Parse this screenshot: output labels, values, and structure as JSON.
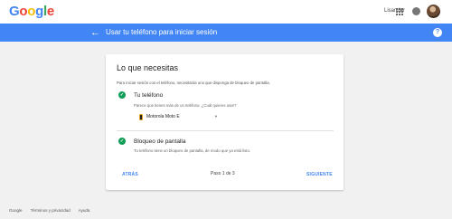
{
  "header": {
    "logo": [
      "G",
      "o",
      "o",
      "g",
      "l",
      "e"
    ],
    "logo_colors": [
      "#4285f4",
      "#ea4335",
      "#fbbc05",
      "#4285f4",
      "#34a853",
      "#ea4335"
    ],
    "user_name": "Lisander"
  },
  "bluebar": {
    "title": "Usar tu teléfono para iniciar sesión",
    "help": "?",
    "back": "←"
  },
  "card": {
    "title": "Lo que necesitas",
    "intro": "Para iniciar sesión con el teléfono, necesitarás uno que disponga de bloqueo de pantalla.",
    "step1": {
      "title": "Tu teléfono",
      "subtitle": "Parece que tienes más de un teléfono. ¿Cuál quieres usar?",
      "device": "Motorola Moto E"
    },
    "step2": {
      "title": "Bloqueo de pantalla",
      "subtitle": "Tu teléfono tiene un bloqueo de pantalla, de modo que ya está listo."
    },
    "back_label": "ATRÁS",
    "page_indicator": "Paso 1 de 3",
    "next_label": "SIGUIENTE"
  },
  "footer": {
    "links": [
      "Google",
      "Términos y privacidad",
      "Ayuda"
    ]
  },
  "colors": {
    "accent": "#4285f4",
    "success": "#0f9d58"
  }
}
